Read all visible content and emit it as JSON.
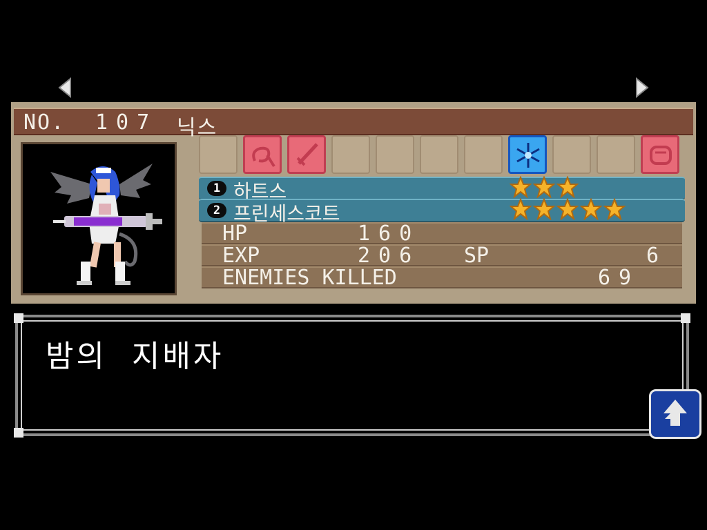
{
  "nav": {
    "prev_icon": "triangle-left-icon",
    "next_icon": "triangle-right-icon"
  },
  "header": {
    "no_label": "NO.",
    "number": "107",
    "name": "닉스"
  },
  "ability_slots": [
    {
      "state": "empty"
    },
    {
      "state": "active",
      "icon": "whip-icon",
      "color": "#e86a78"
    },
    {
      "state": "active",
      "icon": "sword-icon",
      "color": "#e86a78"
    },
    {
      "state": "empty"
    },
    {
      "state": "empty"
    },
    {
      "state": "empty"
    },
    {
      "state": "empty"
    },
    {
      "state": "active",
      "icon": "snowflake-icon",
      "color": "#3aa6f0"
    },
    {
      "state": "empty"
    },
    {
      "state": "empty"
    },
    {
      "state": "active",
      "icon": "fist-icon",
      "color": "#e86a78"
    }
  ],
  "souls": [
    {
      "slot": "1",
      "name": "하트스",
      "stars": 3
    },
    {
      "slot": "2",
      "name": "프린세스코트",
      "stars": 5
    }
  ],
  "stats": {
    "hp_label": "HP",
    "hp": "160",
    "exp_label": "EXP",
    "exp": "206",
    "sp_label": "SP",
    "sp": "6",
    "kills_label": "ENEMIES KILLED",
    "kills": "69"
  },
  "description": {
    "text": "밤의  지배자"
  },
  "colors": {
    "header_bg": "#7c4b38",
    "card_bg": "#b0a086",
    "soul_bar": "#3e7f95",
    "star": "#f5b32a"
  }
}
